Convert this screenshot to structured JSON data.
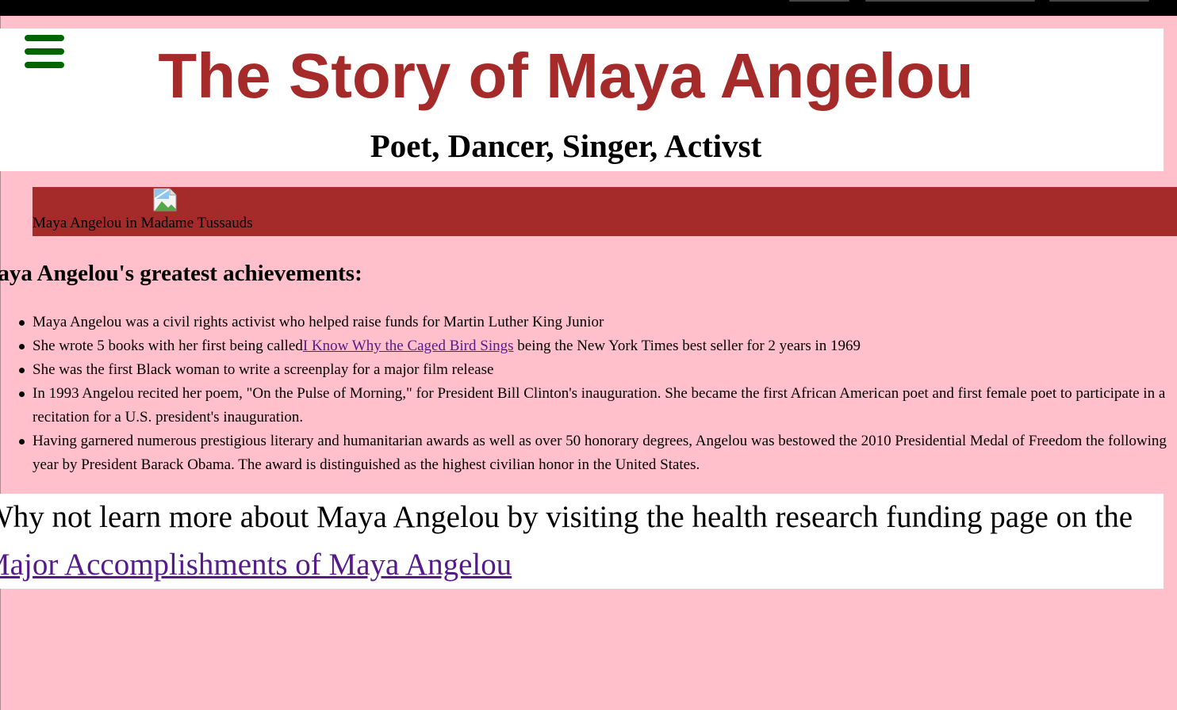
{
  "header": {
    "title": "The Story of Maya Angelou",
    "subtitle": "Poet, Dancer, Singer, Activst"
  },
  "menu": {
    "icon": "hamburger-menu-icon",
    "color": "#006400"
  },
  "figure": {
    "image_icon": "broken-image-icon",
    "caption": "Maya Angelou in Madame Tussauds"
  },
  "achievements": {
    "heading": "Maya Angelou's greatest achievements:",
    "items": [
      {
        "text": "Maya Angelou was a civil rights activist who helped raise funds for Martin Luther King Junior"
      },
      {
        "text_before": "She wrote 5 books with her first being called",
        "link_text": "I Know Why the Caged Bird Sings",
        "text_after": " being the New York Times best seller for 2 years in 1969"
      },
      {
        "text": "She was the first Black woman to write a screenplay for a major film release"
      },
      {
        "text": "In 1993 Angelou recited her poem, \"On the Pulse of Morning,\" for President Bill Clinton's inauguration. She became the first African American poet and first female poet to participate in a recitation for a U.S. president's inauguration."
      },
      {
        "text": "Having garnered numerous prestigious literary and humanitarian awards as well as over 50 honorary degrees, Angelou was bestowed the 2010 Presidential Medal of Freedom the following year by President Barack Obama. The award is distinguished as the highest civilian honor in the United States."
      }
    ]
  },
  "learn_more": {
    "text": "Why not learn more about Maya Angelou by visiting the health research funding page on the",
    "link_text": "Major Accomplishments of Maya Angelou"
  },
  "colors": {
    "page_background": "#ffc0cb",
    "title": "#a52a2a",
    "figure_bar": "#a52a2a",
    "link": "#551a8b",
    "header_background": "#ffffff"
  }
}
